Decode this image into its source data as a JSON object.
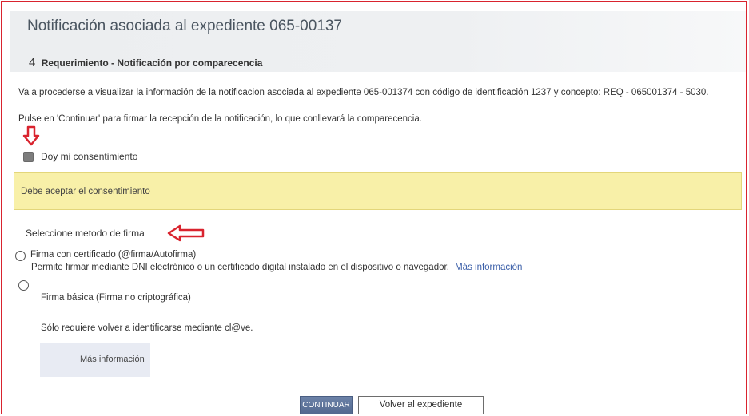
{
  "header": {
    "title": "Notificación asociada al expediente 065-00137",
    "step_number": "4",
    "step_title": "Requerimiento - Notificación por comparecencia"
  },
  "body": {
    "paragraph1": "Va a procederse a visualizar la información de la notificacion asociada al expediente 065-001374 con código de identificación 1237 y concepto: REQ - 065001374 - 5030.",
    "paragraph2": "Pulse en 'Continuar' para firmar la recepción de la notificación, lo que conllevará la comparecencia."
  },
  "consent": {
    "label": "Doy mi consentimiento",
    "checked": false
  },
  "warning": {
    "text": "Debe aceptar el consentimiento"
  },
  "signature": {
    "heading": "Seleccione metodo de firma",
    "options": [
      {
        "label": "Firma con certificado (@firma/Autofirma)",
        "description": "Permite firmar mediante DNI electrónico o un certificado digital instalado en el dispositivo o navegador.",
        "link": "Más información"
      },
      {
        "label": "Firma básica (Firma no criptográfica)",
        "description": "Sólo requiere volver a identificarse mediante cl@ve.",
        "button": "Más información"
      }
    ]
  },
  "actions": {
    "continue": "CONTINUAR",
    "back": "Volver al expediente"
  },
  "colors": {
    "frame_border": "#d9232e",
    "annotation_arrow": "#d9232e",
    "warning_bg": "#f8f0a8",
    "continue_button": "#5f7499",
    "link": "#3a5ea8"
  },
  "icons": {
    "annotation_down": "arrow-down-outline-icon",
    "annotation_left": "arrow-left-outline-icon"
  }
}
